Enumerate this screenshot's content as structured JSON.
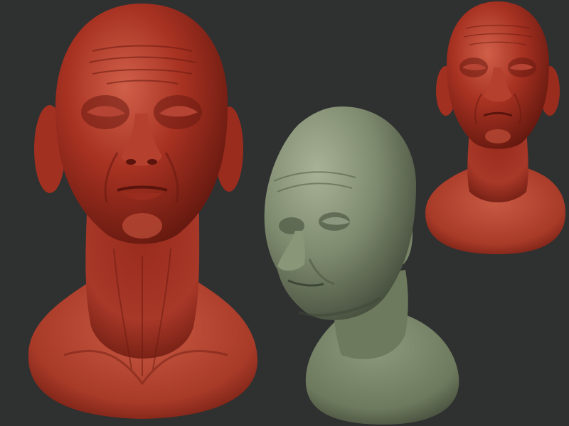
{
  "scene": {
    "background": "#2f3030",
    "busts": [
      {
        "id": "large-red-bust-front",
        "material": "red wax",
        "color": "#a83222",
        "highlight": "#d2604a",
        "shadow": "#5a140c",
        "view": "front"
      },
      {
        "id": "green-bust-three-quarter",
        "material": "clay",
        "color": "#7e8a6e",
        "highlight": "#a4ae92",
        "shadow": "#3e4636",
        "view": "three-quarter"
      },
      {
        "id": "small-red-bust-front",
        "material": "red wax",
        "color": "#a83222",
        "highlight": "#d2604a",
        "shadow": "#5a140c",
        "view": "front"
      }
    ]
  }
}
